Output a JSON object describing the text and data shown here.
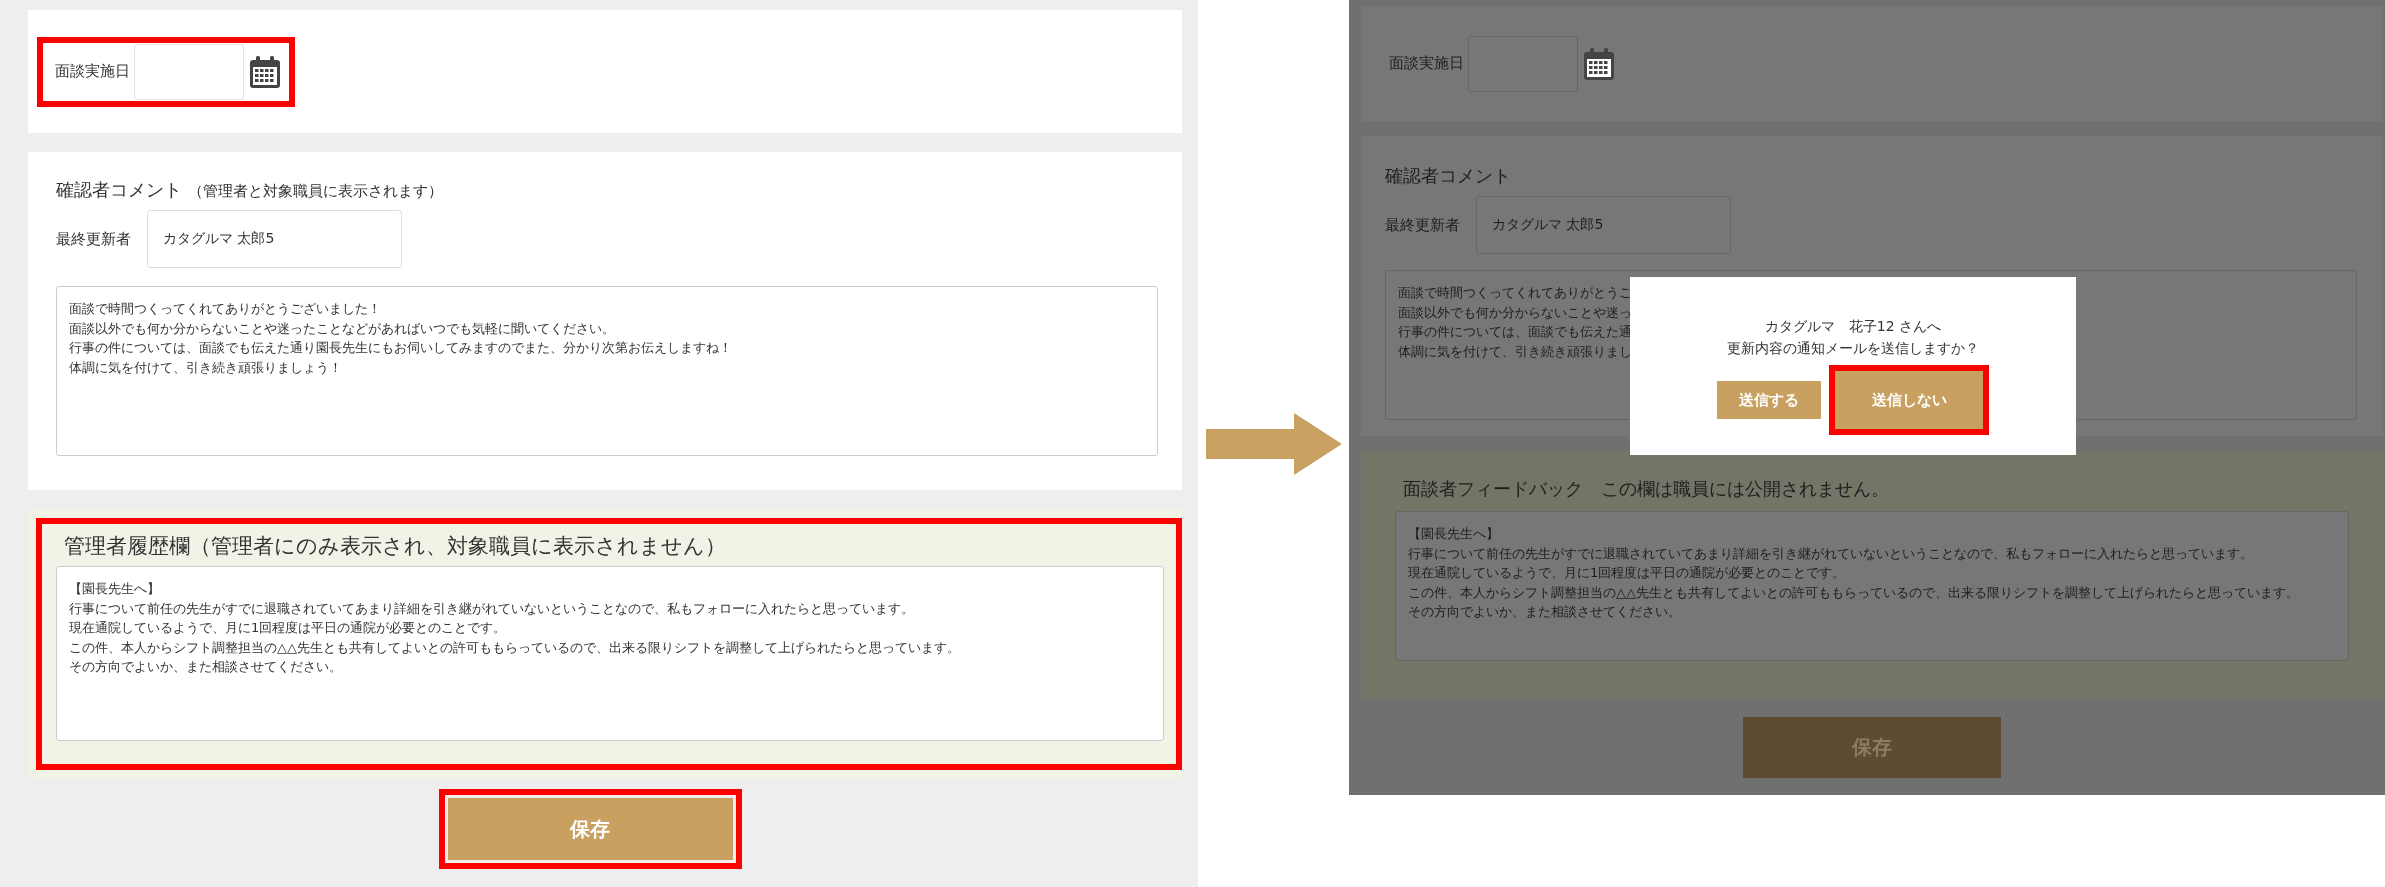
{
  "panels": [
    {
      "dimmed": false,
      "date_section": {
        "label": "面談実施日",
        "highlighted": true
      },
      "reviewer_comment": {
        "title": "確認者コメント",
        "note": "（管理者と対象職員に表示されます）",
        "updater_label": "最終更新者",
        "updater_value": "カタグルマ 太郎5",
        "lines": [
          "面談で時間つくってくれてありがとうございました！",
          "面談以外でも何か分からないことや迷ったことなどがあればいつでも気軽に聞いてください。",
          "行事の件については、面談でも伝えた通り園長先生にもお伺いしてみますのでまた、分かり次第お伝えしますね！",
          "体調に気を付けて、引き続き頑張りましょう！"
        ]
      },
      "history_section": {
        "title": "管理者履歴欄（管理者にのみ表示され、対象職員に表示されません）",
        "highlighted": true,
        "lines": [
          "【園長先生へ】",
          "行事について前任の先生がすでに退職されていてあまり詳細を引き継がれていないということなので、私もフォローに入れたらと思っています。",
          "現在通院しているようで、月に1回程度は平日の通院が必要とのことです。",
          "この件、本人からシフト調整担当の△△先生とも共有してよいとの許可ももらっているので、出来る限りシフトを調整して上げられたらと思っています。",
          "その方向でよいか、また相談させてください。"
        ]
      },
      "save_button": {
        "label": "保存",
        "highlighted": true
      }
    },
    {
      "dimmed": true,
      "date_section": {
        "label": "面談実施日",
        "highlighted": false
      },
      "reviewer_comment": {
        "title": "確認者コメント",
        "updater_label": "最終更新者",
        "updater_value": "カタグルマ 太郎5",
        "lines": [
          "面談で時間つくってくれてありがとうご",
          "面談以外でも何か分からないことや迷っ",
          "行事の件については、面談でも伝えた通",
          "体調に気を付けて、引き続き頑張りまし"
        ]
      },
      "history_section": {
        "title": "面談者フィードバック　この欄は職員には公開されません。",
        "highlighted": false,
        "lines": [
          "【園長先生へ】",
          "行事について前任の先生がすでに退職されていてあまり詳細を引き継がれていないということなので、私もフォローに入れたらと思っています。",
          "現在通院しているようで、月に1回程度は平日の通院が必要とのことです。",
          "この件、本人からシフト調整担当の△△先生とも共有してよいとの許可ももらっているので、出来る限りシフトを調整して上げられたらと思っています。",
          "その方向でよいか、また相談させてください。"
        ]
      },
      "save_button": {
        "label": "保存",
        "highlighted": false
      },
      "dialog": {
        "recipient": "カタグルマ　花子12 さんへ",
        "message": "更新内容の通知メールを送信しますか？",
        "buttons": [
          {
            "label": "送信する",
            "highlighted": false
          },
          {
            "label": "送信しない",
            "highlighted": true
          }
        ]
      }
    }
  ]
}
